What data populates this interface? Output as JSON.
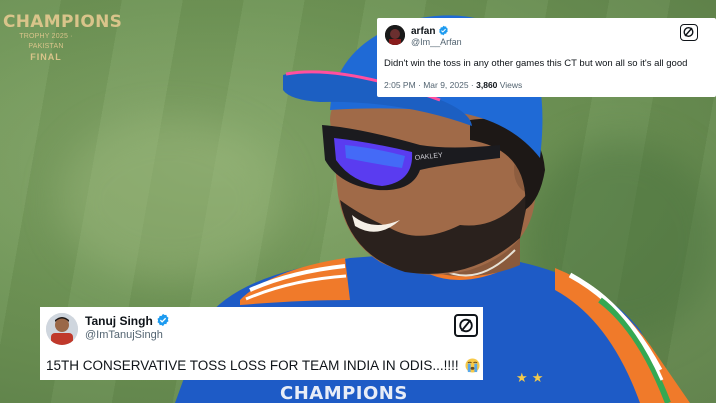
{
  "broadcast": {
    "logo_line1": "CHAMPIONS",
    "logo_line2": "TROPHY 2025 · PAKISTAN",
    "logo_line3": "FINAL",
    "jersey_text": "CHAMPIONS",
    "sunglasses_brand": "OAKLEY"
  },
  "tweet_top": {
    "display_name": "arfan",
    "handle": "@Im__Arfan",
    "text": "Didn't win the toss in any other games this CT but won all so it's all good",
    "time": "2:05 PM · Mar 9, 2025 · ",
    "views_count": "3,860",
    "views_label": " Views"
  },
  "tweet_bottom": {
    "display_name": "Tanuj Singh",
    "handle": "@ImTanujSingh",
    "text": "15TH CONSERVATIVE TOSS LOSS FOR TEAM INDIA IN ODIS...!!!!"
  },
  "colors": {
    "verified_blue": "#1d9bf0",
    "cap_blue": "#1f6ad6",
    "jersey_blue": "#1e5bc6",
    "grass_green": "#6f9556",
    "logo_gold": "#d9c48a"
  },
  "icons": [
    "verified-badge-icon",
    "x-share-icon",
    "sob-emoji-icon"
  ]
}
